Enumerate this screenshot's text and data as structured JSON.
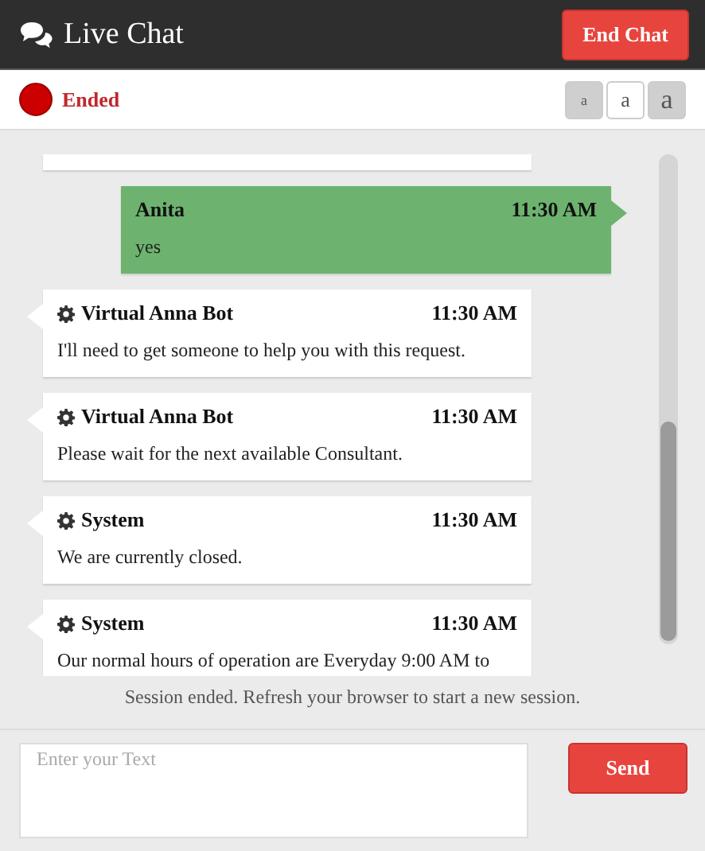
{
  "header": {
    "title": "Live Chat",
    "end_button": "End Chat"
  },
  "status": {
    "label": "Ended"
  },
  "font_sizes": [
    {
      "label": "a",
      "selected": false
    },
    {
      "label": "a",
      "selected": true
    },
    {
      "label": "a",
      "selected": false
    }
  ],
  "messages": [
    {
      "kind": "visitor",
      "sender": "Anita",
      "time": "11:30 AM",
      "text": "yes"
    },
    {
      "kind": "bot",
      "sender": "Virtual Anna Bot",
      "time": "11:30 AM",
      "text": "I'll need to get someone to help you with this request."
    },
    {
      "kind": "bot",
      "sender": "Virtual Anna Bot",
      "time": "11:30 AM",
      "text": "Please wait for the next available Consultant."
    },
    {
      "kind": "bot",
      "sender": "System",
      "time": "11:30 AM",
      "text": "We are currently closed."
    },
    {
      "kind": "bot",
      "sender": "System",
      "time": "11:30 AM",
      "text": "Our normal hours of operation are Everyday 9:00 AM to"
    }
  ],
  "notice": "Session ended. Refresh your browser to start a new session.",
  "composer": {
    "placeholder": "Enter your Text",
    "send_button": "Send"
  }
}
